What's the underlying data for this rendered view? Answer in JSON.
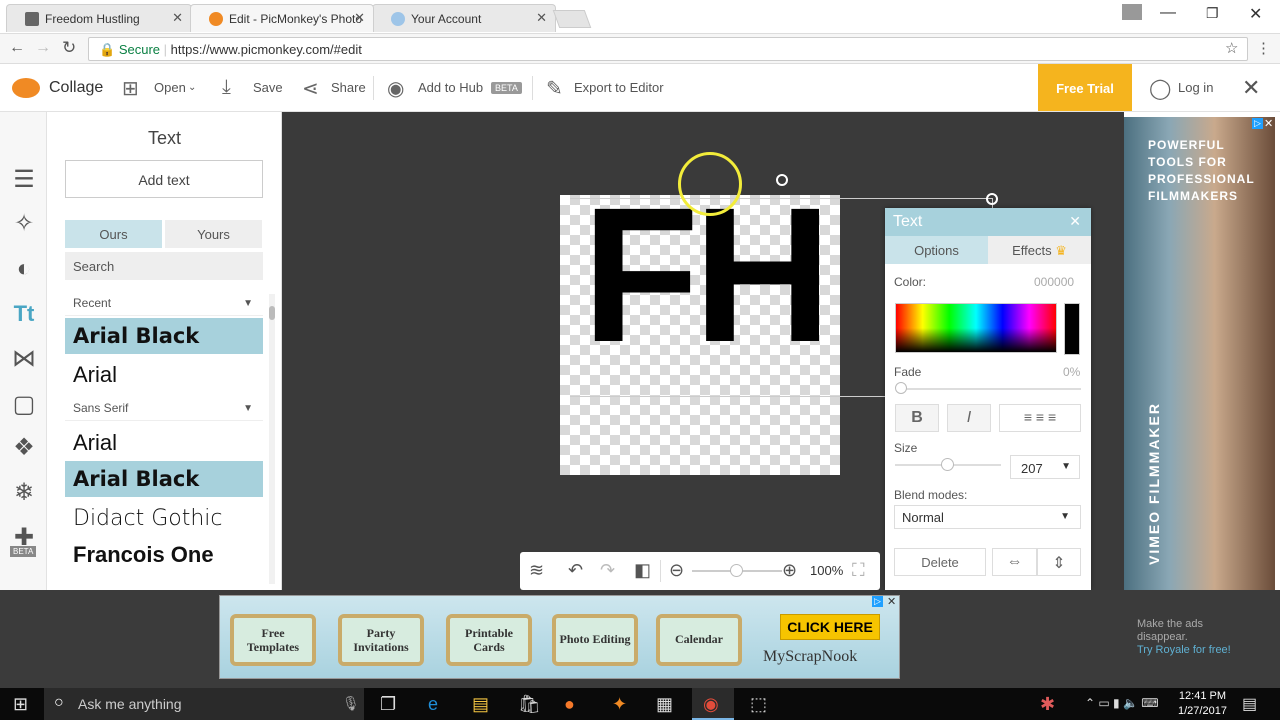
{
  "browser": {
    "tabs": [
      {
        "title": "Freedom Hustling",
        "favicon": "fh-favicon-icon",
        "active": false
      },
      {
        "title": "Edit - PicMonkey's Photo",
        "favicon": "picmonkey-favicon-icon",
        "active": true
      },
      {
        "title": "Your Account",
        "favicon": "account-favicon-icon",
        "active": false
      }
    ],
    "secure_label": "Secure",
    "url": "https://www.picmonkey.com/#edit"
  },
  "toolbar": {
    "logo_label": "Collage",
    "open_label": "Open",
    "save_label": "Save",
    "share_label": "Share",
    "hub_label": "Add to Hub",
    "hub_badge": "BETA",
    "export_label": "Export to Editor",
    "free_trial_label": "Free Trial",
    "login_label": "Log in"
  },
  "rail": {
    "beta_badge": "BETA"
  },
  "panel": {
    "title": "Text",
    "add_text_label": "Add text",
    "seg_ours": "Ours",
    "seg_yours": "Yours",
    "search_placeholder": "Search",
    "dropdown_recent": "Recent",
    "dropdown_sans": "Sans Serif",
    "fonts_recent": [
      "Arial Black",
      "Arial"
    ],
    "fonts_sans": [
      "Arial",
      "Arial Black",
      "Didact Gothic",
      "Francois One"
    ]
  },
  "canvas": {
    "text": "FH"
  },
  "text_dialog": {
    "title": "Text",
    "tab_options": "Options",
    "tab_effects": "Effects",
    "color_label": "Color:",
    "color_value": "000000",
    "fade_label": "Fade",
    "fade_value": "0%",
    "bold_label": "B",
    "italic_label": "I",
    "size_label": "Size",
    "size_value": "207",
    "blend_label": "Blend modes:",
    "blend_value": "Normal",
    "delete_label": "Delete"
  },
  "zoom": {
    "value": "100%"
  },
  "ad_right": {
    "headline": "POWERFUL TOOLS FOR PROFESSIONAL FILMMAKERS",
    "vertical_text": "VIMEO FILMMAKER"
  },
  "ad_bottom": {
    "buttons": [
      "Free Templates",
      "Party Invitations",
      "Printable Cards",
      "Photo Editing",
      "Calendar"
    ],
    "cta": "CLICK HERE",
    "brand": "MyScrapNook"
  },
  "remove_ads": {
    "line1": "Make the ads",
    "line2": "disappear.",
    "link": "Try Royale for free!"
  },
  "taskbar": {
    "search_placeholder": "Ask me anything",
    "time": "12:41 PM",
    "date": "1/27/2017"
  },
  "colors": {
    "accent_teal": "#a7d1dc",
    "free_trial": "#f5b41e",
    "workspace": "#3a3a3a"
  }
}
